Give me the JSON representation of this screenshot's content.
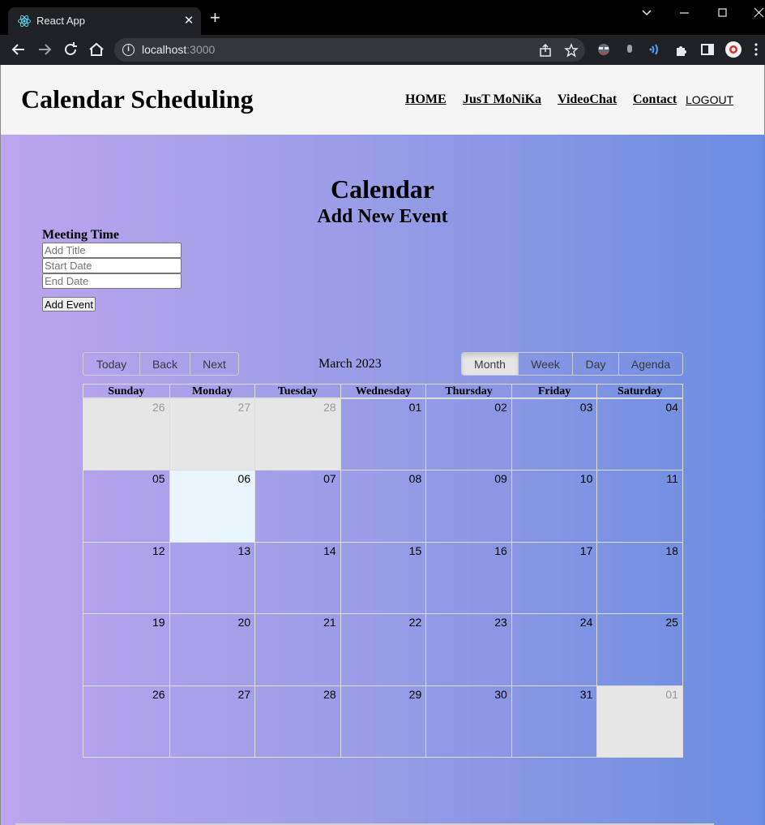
{
  "browser": {
    "tab_title": "React App",
    "url_host": "localhost",
    "url_port": ":3000"
  },
  "header": {
    "brand": "Calendar Scheduling",
    "nav": [
      "HOME",
      "JusT MoNiKa",
      "VideoChat",
      "Contact"
    ],
    "logout": "LOGOUT"
  },
  "main": {
    "title": "Calendar",
    "subtitle": "Add New Event",
    "form_label": "Meeting Time",
    "title_placeholder": "Add Title",
    "start_placeholder": "Start Date",
    "end_placeholder": "End Date",
    "add_button": "Add Event"
  },
  "calendar": {
    "nav_buttons": [
      "Today",
      "Back",
      "Next"
    ],
    "label": "March 2023",
    "views": [
      "Month",
      "Week",
      "Day",
      "Agenda"
    ],
    "active_view": "Month",
    "weekdays": [
      "Sunday",
      "Monday",
      "Tuesday",
      "Wednesday",
      "Thursday",
      "Friday",
      "Saturday"
    ],
    "weeks": [
      [
        "26",
        "27",
        "28",
        "01",
        "02",
        "03",
        "04"
      ],
      [
        "05",
        "06",
        "07",
        "08",
        "09",
        "10",
        "11"
      ],
      [
        "12",
        "13",
        "14",
        "15",
        "16",
        "17",
        "18"
      ],
      [
        "19",
        "20",
        "21",
        "22",
        "23",
        "24",
        "25"
      ],
      [
        "26",
        "27",
        "28",
        "29",
        "30",
        "31",
        "01"
      ]
    ],
    "off_range": [
      [
        0,
        0
      ],
      [
        0,
        1
      ],
      [
        0,
        2
      ],
      [
        4,
        6
      ]
    ],
    "today": [
      1,
      1
    ]
  }
}
